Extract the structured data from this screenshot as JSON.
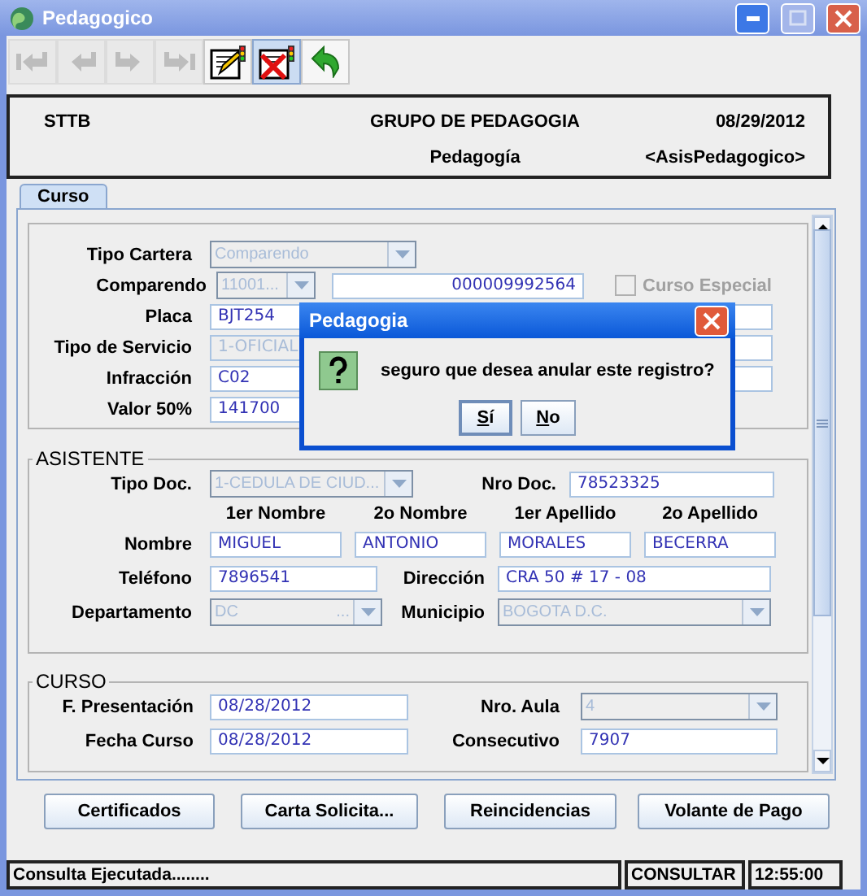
{
  "window": {
    "title": "Pedagogico"
  },
  "toolbar": [
    {
      "kind": "first",
      "disabled": true,
      "pressed": false
    },
    {
      "kind": "previous",
      "disabled": true,
      "pressed": false
    },
    {
      "kind": "next",
      "disabled": true,
      "pressed": false
    },
    {
      "kind": "last",
      "disabled": true,
      "pressed": false
    },
    {
      "kind": "edit",
      "disabled": false,
      "pressed": false
    },
    {
      "kind": "delete",
      "disabled": false,
      "pressed": true
    },
    {
      "kind": "back",
      "disabled": false,
      "pressed": false
    }
  ],
  "header": {
    "company": "STTB",
    "group": "GRUPO DE PEDAGOGIA",
    "date": "08/29/2012",
    "module": "Pedagogía",
    "form": "<AsisPedagogico>"
  },
  "tabs": [
    {
      "label": "Curso",
      "selected": true
    }
  ],
  "vehiculo": {
    "tipo_cartera": {
      "label": "Tipo Cartera",
      "value": "Comparendo",
      "disabled": true
    },
    "comparendo": {
      "label": "Comparendo",
      "prefix": "11001...",
      "prefix_disabled": true,
      "number": "000009992564"
    },
    "curso_especial": {
      "label": "Curso Especial",
      "checked": false,
      "disabled": true
    },
    "placa": {
      "label": "Placa",
      "value": "BJT254"
    },
    "tipo_servicio": {
      "label": "Tipo de Servicio",
      "value": "1-OFICIAL",
      "disabled": true
    },
    "infraccion": {
      "label": "Infracción",
      "value": "C02"
    },
    "valor": {
      "label": "Valor 50%",
      "value": "141700"
    }
  },
  "asistente": {
    "title": "ASISTENTE",
    "tipo_doc": {
      "label": "Tipo Doc.",
      "value": "1-CEDULA DE CIUD...",
      "disabled": true
    },
    "nro_doc": {
      "label": "Nro Doc.",
      "value": "78523325"
    },
    "name_columns": [
      "1er Nombre",
      "2o Nombre",
      "1er Apellido",
      "2o Apellido"
    ],
    "nombre": {
      "label": "Nombre",
      "values": [
        "MIGUEL",
        "ANTONIO",
        "MORALES",
        "BECERRA"
      ]
    },
    "telefono": {
      "label": "Teléfono",
      "value": "7896541"
    },
    "direccion": {
      "label": "Dirección",
      "value": "CRA 50 # 17 - 08"
    },
    "departamento": {
      "label": "Departamento",
      "value": "DC",
      "suffix": "...",
      "disabled": true
    },
    "municipio": {
      "label": "Municipio",
      "value": "BOGOTA D.C.",
      "disabled": true
    }
  },
  "curso": {
    "title": "CURSO",
    "f_presentacion": {
      "label": "F. Presentación",
      "value": "08/28/2012"
    },
    "nro_aula": {
      "label": "Nro. Aula",
      "value": "4",
      "disabled": true
    },
    "fecha_curso": {
      "label": "Fecha Curso",
      "value": "08/28/2012"
    },
    "consecutivo": {
      "label": "Consecutivo",
      "value": "7907"
    }
  },
  "actions": [
    "Certificados",
    "Carta Solicita...",
    "Reincidencias",
    "Volante de Pago"
  ],
  "status": {
    "message": "Consulta Ejecutada........",
    "mode": "CONSULTAR",
    "time": "12:55:00"
  },
  "dialog": {
    "title": "Pedagogia",
    "message": "seguro que desea anular este registro?",
    "buttons": [
      {
        "label": "Sí",
        "focused": true
      },
      {
        "label": "No",
        "focused": false
      }
    ]
  }
}
